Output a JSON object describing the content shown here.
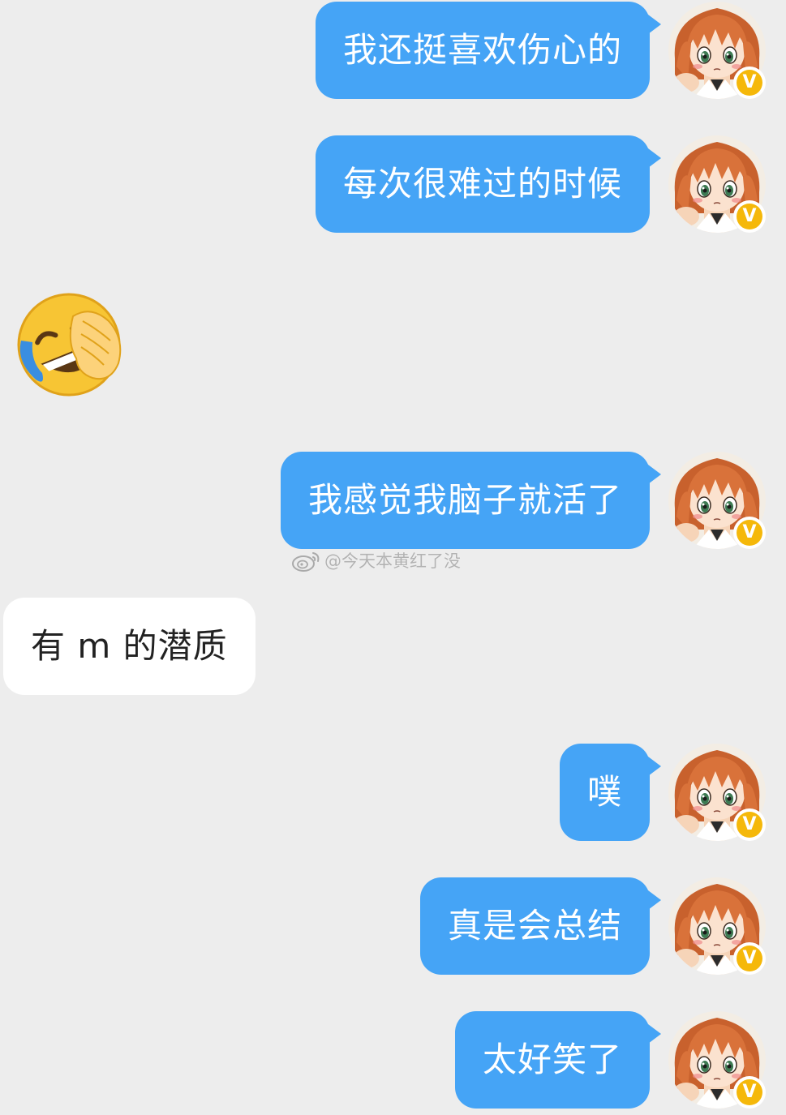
{
  "messages": [
    {
      "side": "out",
      "text": "我还挺喜欢伤心的"
    },
    {
      "side": "out",
      "text": "每次很难过的时候"
    },
    {
      "side": "in",
      "type": "emoji",
      "emoji": "rolling-on-the-floor-laughing-emoji"
    },
    {
      "side": "out",
      "text": "我感觉我脑子就活了"
    },
    {
      "side": "in",
      "text": "有 m 的潜质"
    },
    {
      "side": "out",
      "text": "噗"
    },
    {
      "side": "out",
      "text": "真是会总结"
    },
    {
      "side": "out",
      "text": "太好笑了"
    }
  ],
  "watermark": {
    "icon": "weibo-logo-icon",
    "text": "@今天本黄红了没"
  },
  "avatar": {
    "icon": "anime-girl-avatar",
    "badge": "V",
    "badge_color": "#f5b80a"
  },
  "colors": {
    "background": "#ededed",
    "outgoing_bubble": "#45a4f6",
    "incoming_bubble": "#ffffff"
  }
}
